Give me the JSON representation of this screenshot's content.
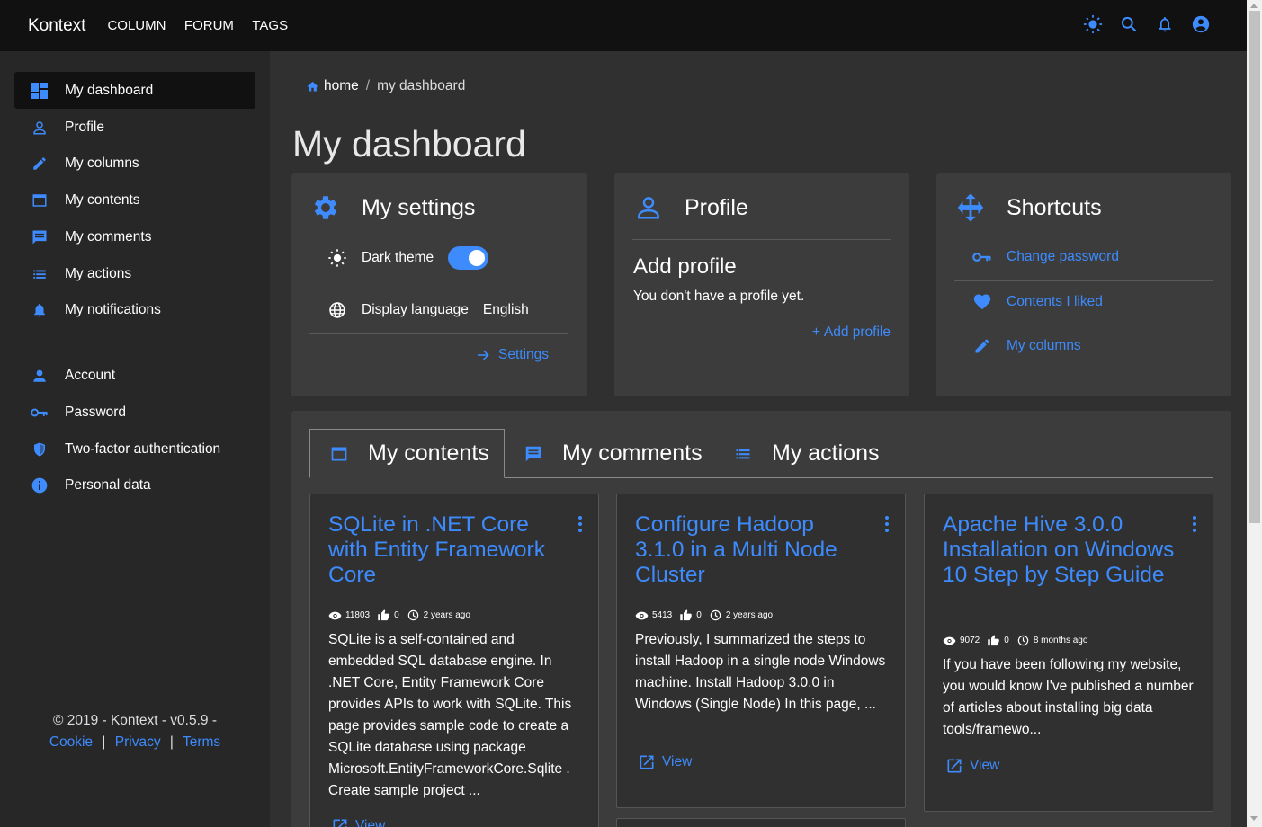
{
  "colors": {
    "accent": "#3d8bfd",
    "topbar": "#111111",
    "sidebar": "#272727",
    "main": "#303030",
    "card": "#3c3c3c"
  },
  "topbar": {
    "brand": "Kontext",
    "nav": [
      "COLUMN",
      "FORUM",
      "TAGS"
    ],
    "icons": [
      "theme-icon",
      "search-icon",
      "bell-icon",
      "account-circle-icon"
    ]
  },
  "sidebar": {
    "items": [
      {
        "label": "My dashboard",
        "icon": "dashboard-icon"
      },
      {
        "label": "Profile",
        "icon": "person-outline-icon"
      },
      {
        "label": "My columns",
        "icon": "pencil-icon"
      },
      {
        "label": "My contents",
        "icon": "window-icon"
      },
      {
        "label": "My comments",
        "icon": "comment-icon"
      },
      {
        "label": "My actions",
        "icon": "list-icon"
      },
      {
        "label": "My notifications",
        "icon": "bell-icon"
      }
    ],
    "account_items": [
      {
        "label": "Account",
        "icon": "person-icon"
      },
      {
        "label": "Password",
        "icon": "key-icon"
      },
      {
        "label": "Two-factor authentication",
        "icon": "shield-icon"
      },
      {
        "label": "Personal data",
        "icon": "info-icon"
      }
    ],
    "footer": {
      "copyright": "© 2019 - Kontext - v0.5.9 -",
      "cookie": "Cookie",
      "privacy": "Privacy",
      "terms": "Terms",
      "sep": "|"
    }
  },
  "breadcrumb": {
    "home": "home",
    "sep": "/",
    "current": "my dashboard"
  },
  "page_title": "My dashboard",
  "settings_card": {
    "title": "My settings",
    "dark_theme_label": "Dark theme",
    "dark_theme_on": true,
    "language_label": "Display language",
    "language_value": "English",
    "settings_link": "Settings"
  },
  "profile_card": {
    "title": "Profile",
    "heading": "Add profile",
    "text": "You don't have a profile yet.",
    "add_link": "Add profile",
    "plus": "+"
  },
  "shortcuts_card": {
    "title": "Shortcuts",
    "links": [
      {
        "label": "Change password",
        "icon": "key-icon"
      },
      {
        "label": "Contents I liked",
        "icon": "heart-icon"
      },
      {
        "label": "My columns",
        "icon": "pencil-icon"
      }
    ]
  },
  "tabs": [
    {
      "label": "My contents",
      "icon": "window-icon",
      "active": true
    },
    {
      "label": "My comments",
      "icon": "comment-icon",
      "active": false
    },
    {
      "label": "My actions",
      "icon": "list-icon",
      "active": false
    }
  ],
  "posts": [
    {
      "title": "SQLite in .NET Core with Entity Framework Core",
      "views": "11803",
      "likes": "0",
      "time": "2 years ago",
      "desc": "SQLite is a self-contained and embedded SQL database engine. In .NET Core, Entity Framework Core provides APIs to work with SQLite. This page provides sample code to create a SQLite database using package Microsoft.EntityFrameworkCore.Sqlite . Create sample project ...",
      "view_label": "View"
    },
    {
      "title": "Configure Hadoop 3.1.0 in a Multi Node Cluster",
      "views": "5413",
      "likes": "0",
      "time": "2 years ago",
      "desc": "Previously, I summarized the steps to install Hadoop in a single node Windows machine. Install Hadoop 3.0.0 in Windows (Single Node) In this page, ...",
      "view_label": "View"
    },
    {
      "title": "Apache Hive 3.0.0 Installation on Windows 10 Step by Step Guide",
      "views": "9072",
      "likes": "0",
      "time": "8 months ago",
      "desc": "If you have been following my website, you would know I've published a number of articles about installing big data tools/framewo...",
      "view_label": "View"
    }
  ]
}
